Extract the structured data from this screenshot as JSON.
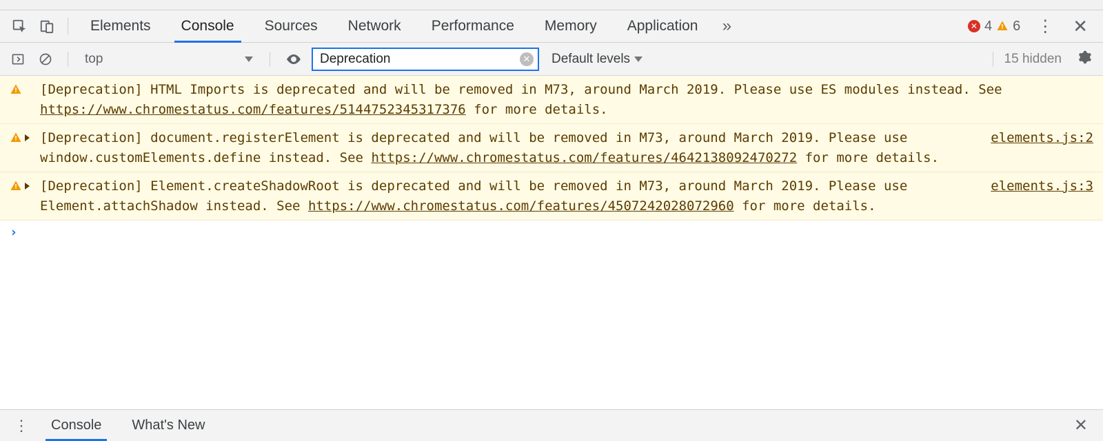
{
  "tabs": {
    "items": [
      "Elements",
      "Console",
      "Sources",
      "Network",
      "Performance",
      "Memory",
      "Application"
    ],
    "activeIndex": 1
  },
  "badges": {
    "errors": "4",
    "warnings": "6"
  },
  "console": {
    "context": "top",
    "filter_value": "Deprecation",
    "levels_label": "Default levels",
    "hidden_label": "15 hidden"
  },
  "messages": [
    {
      "level": "warning",
      "has_disclosure": false,
      "text_before": "[Deprecation] HTML Imports is deprecated and will be removed in M73, around March 2019. Please use ES modules instead. See ",
      "link": "https://www.chromestatus.com/features/5144752345317376",
      "text_after": " for more details.",
      "source": ""
    },
    {
      "level": "warning",
      "has_disclosure": true,
      "text_before": "[Deprecation] document.registerElement is deprecated and will be removed in M73, around March 2019. Please use window.customElements.define instead. See ",
      "link": "https://www.chromestatus.com/features/4642138092470272",
      "text_after": " for more details.",
      "source": "elements.js:2"
    },
    {
      "level": "warning",
      "has_disclosure": true,
      "text_before": "[Deprecation] Element.createShadowRoot is deprecated and will be removed in M73, around March 2019. Please use Element.attachShadow instead. See ",
      "link": "https://www.chromestatus.com/features/4507242028072960",
      "text_after": " for more details.",
      "source": "elements.js:3"
    }
  ],
  "drawer": {
    "tabs": [
      "Console",
      "What's New"
    ],
    "activeIndex": 0
  }
}
